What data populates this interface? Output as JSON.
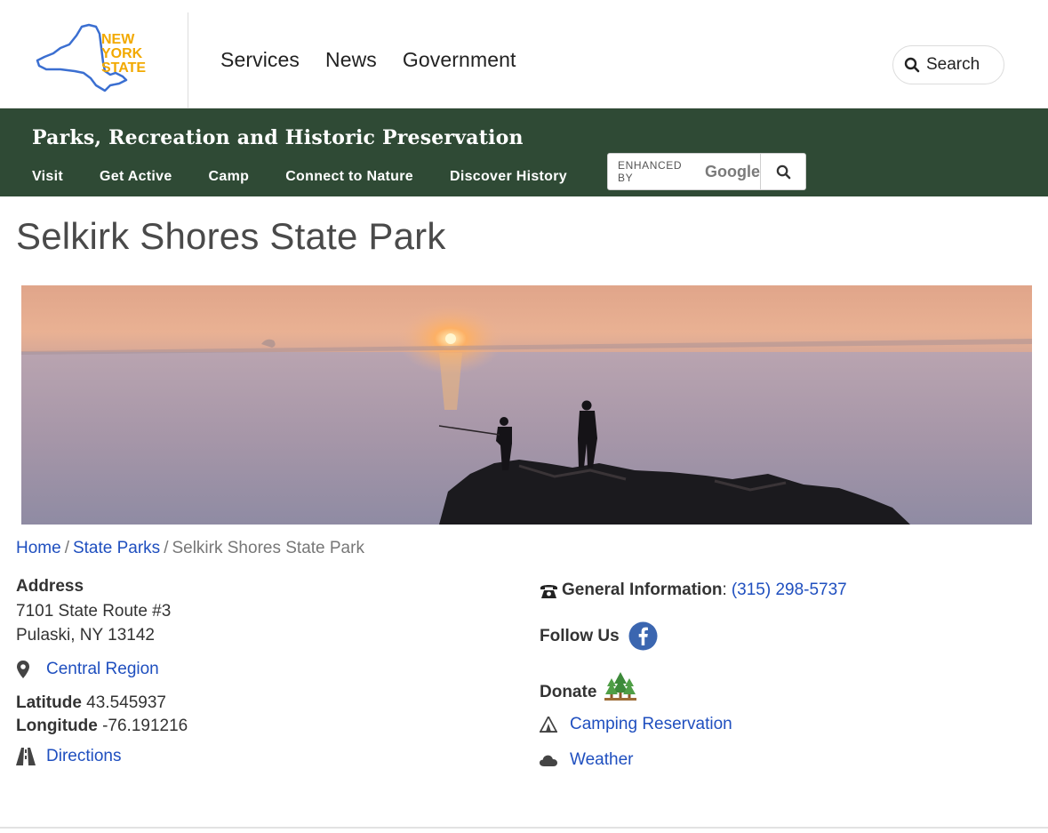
{
  "header": {
    "logo_text": "NEW YORK STATE",
    "nav": [
      "Services",
      "News",
      "Government"
    ],
    "search_label": "Search"
  },
  "agency": {
    "title": "Parks, Recreation and Historic Preservation",
    "nav": [
      "Visit",
      "Get Active",
      "Camp",
      "Connect to Nature",
      "Discover History"
    ],
    "search_enhanced": "ENHANCED BY",
    "search_google": "Google"
  },
  "page": {
    "title": "Selkirk Shores State Park"
  },
  "breadcrumb": {
    "home": "Home",
    "parks": "State Parks",
    "current": "Selkirk Shores State Park",
    "separator": "/"
  },
  "info": {
    "address_label": "Address",
    "address_line1": "7101 State Route #3",
    "address_line2": "Pulaski, NY 13142",
    "region": "Central Region",
    "latitude_label": "Latitude",
    "latitude": "43.545937",
    "longitude_label": "Longitude",
    "longitude": "-76.191216",
    "directions": "Directions"
  },
  "contact": {
    "general_label": "General Information",
    "phone": "(315) 298-5737",
    "follow_label": "Follow Us",
    "donate_label": "Donate",
    "camping": "Camping Reservation",
    "weather": "Weather"
  },
  "colors": {
    "agency_bar": "#2f4a35",
    "link": "#1f4fbf",
    "logo_orange": "#f2a900",
    "logo_blue": "#3b6fd1",
    "facebook": "#3b66b0"
  }
}
